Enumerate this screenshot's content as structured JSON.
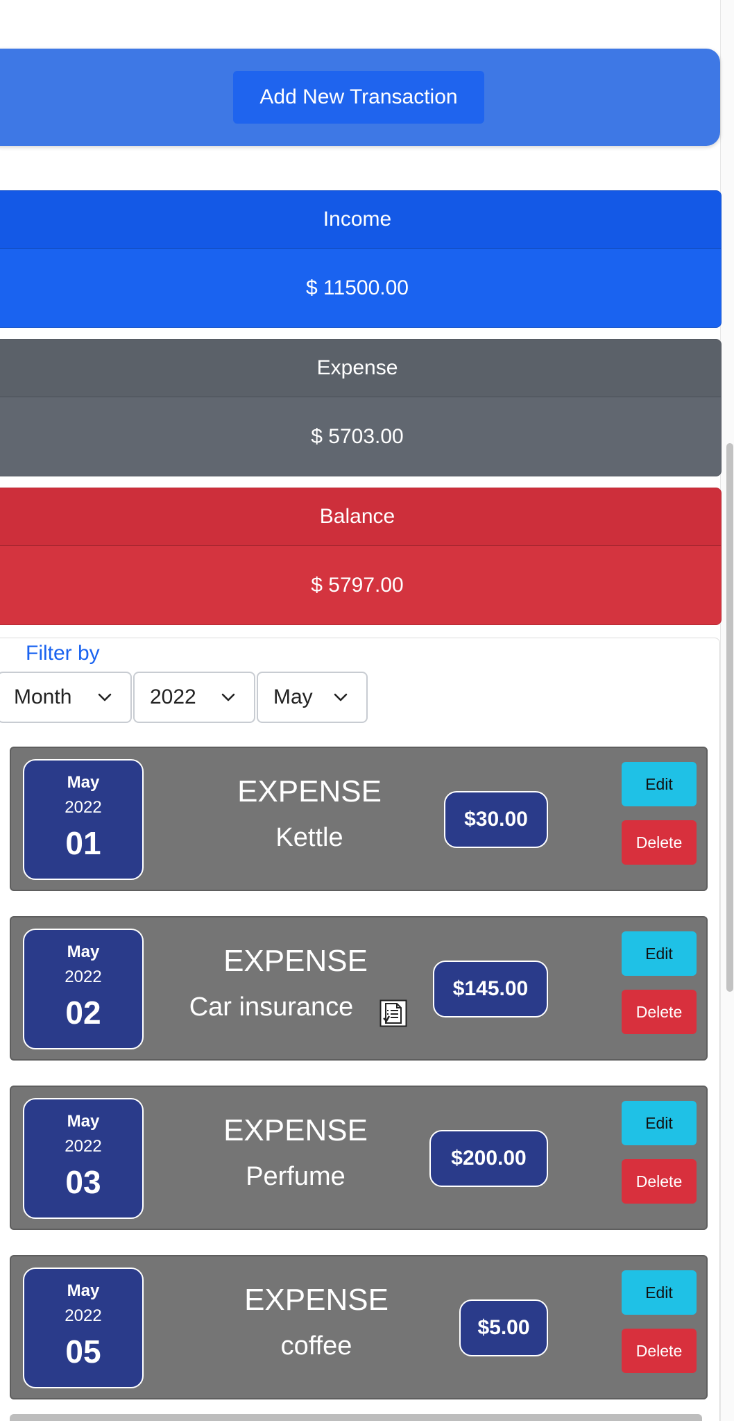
{
  "header": {
    "add_button_label": "Add New Transaction"
  },
  "summary": {
    "income": {
      "title": "Income",
      "amount": "$ 11500.00"
    },
    "expense": {
      "title": "Expense",
      "amount": "$ 5703.00"
    },
    "balance": {
      "title": "Balance",
      "amount": "$ 5797.00"
    }
  },
  "filter": {
    "label": "Filter by",
    "period_type": "Month",
    "year": "2022",
    "month": "May"
  },
  "transactions": [
    {
      "month": "May",
      "year": "2022",
      "day": "01",
      "type": "EXPENSE",
      "description": "Kettle",
      "amount": "$30.00",
      "has_receipt": false,
      "edit_label": "Edit",
      "delete_label": "Delete"
    },
    {
      "month": "May",
      "year": "2022",
      "day": "02",
      "type": "EXPENSE",
      "description": "Car insurance",
      "amount": "$145.00",
      "has_receipt": true,
      "edit_label": "Edit",
      "delete_label": "Delete"
    },
    {
      "month": "May",
      "year": "2022",
      "day": "03",
      "type": "EXPENSE",
      "description": "Perfume",
      "amount": "$200.00",
      "has_receipt": false,
      "edit_label": "Edit",
      "delete_label": "Delete"
    },
    {
      "month": "May",
      "year": "2022",
      "day": "05",
      "type": "EXPENSE",
      "description": "coffee",
      "amount": "$5.00",
      "has_receipt": false,
      "edit_label": "Edit",
      "delete_label": "Delete"
    }
  ],
  "icons": {
    "dropdown": "chevron-down-icon",
    "receipt": "receipt-icon"
  },
  "colors": {
    "primary": "#1a63f0",
    "secondary": "#616770",
    "danger": "#d4343f",
    "info": "#1fc1e6",
    "card": "#757575",
    "date_badge": "#2a3b8a"
  }
}
